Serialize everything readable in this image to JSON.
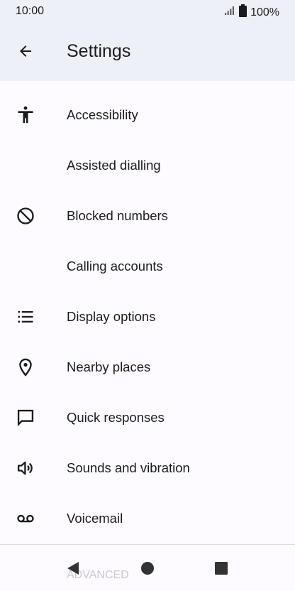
{
  "status_bar": {
    "time": "10:00",
    "battery": "100%"
  },
  "app_bar": {
    "title": "Settings",
    "back_icon": "arrow-back-icon"
  },
  "settings_items": [
    {
      "label": "Accessibility",
      "icon": "accessibility-icon"
    },
    {
      "label": "Assisted dialling",
      "icon": ""
    },
    {
      "label": "Blocked numbers",
      "icon": "block-icon"
    },
    {
      "label": "Calling accounts",
      "icon": ""
    },
    {
      "label": "Display options",
      "icon": "list-icon"
    },
    {
      "label": "Nearby places",
      "icon": "location-pin-icon"
    },
    {
      "label": "Quick responses",
      "icon": "chat-bubble-icon"
    },
    {
      "label": "Sounds and vibration",
      "icon": "volume-icon"
    },
    {
      "label": "Voicemail",
      "icon": "voicemail-icon"
    }
  ],
  "advanced_label": "ADVANCED",
  "nav_bar": {
    "back": "nav-back-icon",
    "home": "nav-home-icon",
    "recents": "nav-recents-icon"
  },
  "colors": {
    "background": "#fdfbff",
    "top_bar": "#eef0f7",
    "text": "#1b1b1f",
    "icon": "#44464f"
  }
}
